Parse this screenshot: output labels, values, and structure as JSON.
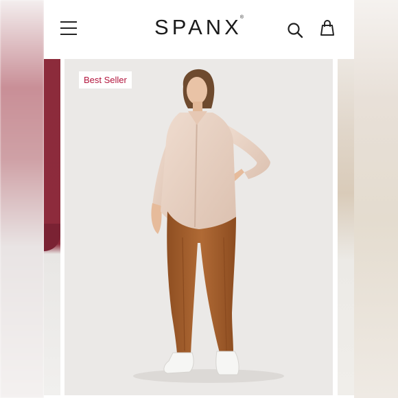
{
  "header": {
    "brand": "SPANX",
    "brand_mark": "®",
    "menu_icon": "hamburger-menu-icon",
    "search_icon": "search-icon",
    "bag_icon": "shopping-bag-icon"
  },
  "product": {
    "badge": "Best Seller",
    "colors": {
      "badge_text": "#b2143c",
      "legging": "#a8622e",
      "shirt": "#e9d2c4",
      "background": "#ebe9e7"
    }
  }
}
